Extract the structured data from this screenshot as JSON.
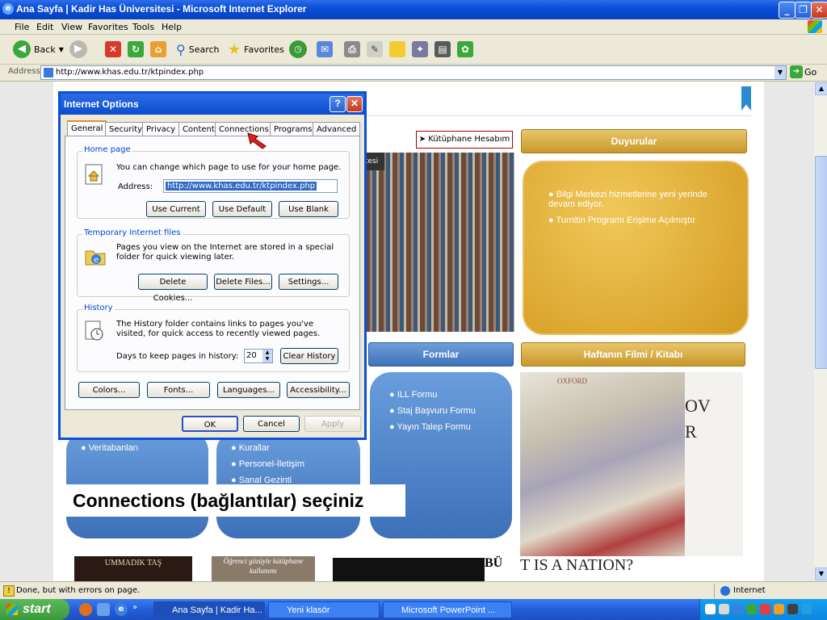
{
  "window": {
    "title": "Ana Sayfa | Kadir Has Üniversitesi - Microsoft Internet Explorer"
  },
  "menu": [
    "File",
    "Edit",
    "View",
    "Favorites",
    "Tools",
    "Help"
  ],
  "toolbar": {
    "back": "Back",
    "search": "Search",
    "favorites": "Favorites"
  },
  "address": {
    "label": "Address",
    "url": "http://www.khas.edu.tr/ktpindex.php",
    "go": "Go"
  },
  "page": {
    "kutuphane": "Kütüphane Hesabım",
    "tesi": "tesi",
    "duyurular": {
      "title": "Duyurular",
      "items": [
        "Bilgi Merkezi hizmetlerine yeni yerinde devam ediyor.",
        "Turnitin Programı Erişime Açılmıştır"
      ]
    },
    "formlar": {
      "title": "Formlar",
      "items": [
        "ILL Formu",
        "Staj Başvuru Formu",
        "Yayın Talep Formu"
      ]
    },
    "haftanin": "Haftanın Filmi / Kitabı",
    "left_list": [
      "Veritabanları"
    ],
    "mid_list": [
      "Kurallar",
      "Personel-İletişim",
      "Sanal Gezinti"
    ],
    "book_oxford": "OXFORD",
    "book_right_letters": "OV R",
    "book_title": "T IS A NATION?",
    "bottom_book1": "UMMADIK TAŞ",
    "bottom_book2": "Öğrenci gözüyle kütüphane kullanımı",
    "bottom_bu": "BÜ"
  },
  "dialog": {
    "title": "Internet Options",
    "tabs": [
      "General",
      "Security",
      "Privacy",
      "Content",
      "Connections",
      "Programs",
      "Advanced"
    ],
    "home": {
      "legend": "Home page",
      "desc": "You can change which page to use for your home page.",
      "address_label": "Address:",
      "address_value": "http://www.khas.edu.tr/ktpindex.php",
      "btn_current": "Use Current",
      "btn_default": "Use Default",
      "btn_blank": "Use Blank"
    },
    "temp": {
      "legend": "Temporary Internet files",
      "desc": "Pages you view on the Internet are stored in a special folder for quick viewing later.",
      "btn_cookies": "Delete Cookies...",
      "btn_files": "Delete Files...",
      "btn_settings": "Settings..."
    },
    "history": {
      "legend": "History",
      "desc": "The History folder contains links to pages you've visited, for quick access to recently viewed pages.",
      "days_label": "Days to keep pages in history:",
      "days_value": "20",
      "btn_clear": "Clear History"
    },
    "bottom": {
      "colors": "Colors...",
      "fonts": "Fonts...",
      "languages": "Languages...",
      "accessibility": "Accessibility..."
    },
    "ok": "OK",
    "cancel": "Cancel",
    "apply": "Apply"
  },
  "caption": "Connections (bağlantılar) seçiniz",
  "status": {
    "text": "Done, but with errors on page.",
    "zone": "Internet"
  },
  "taskbar": {
    "start": "start",
    "tasks": [
      "Ana Sayfa | Kadir Ha...",
      "Yeni klasör",
      "Microsoft PowerPoint ..."
    ]
  }
}
